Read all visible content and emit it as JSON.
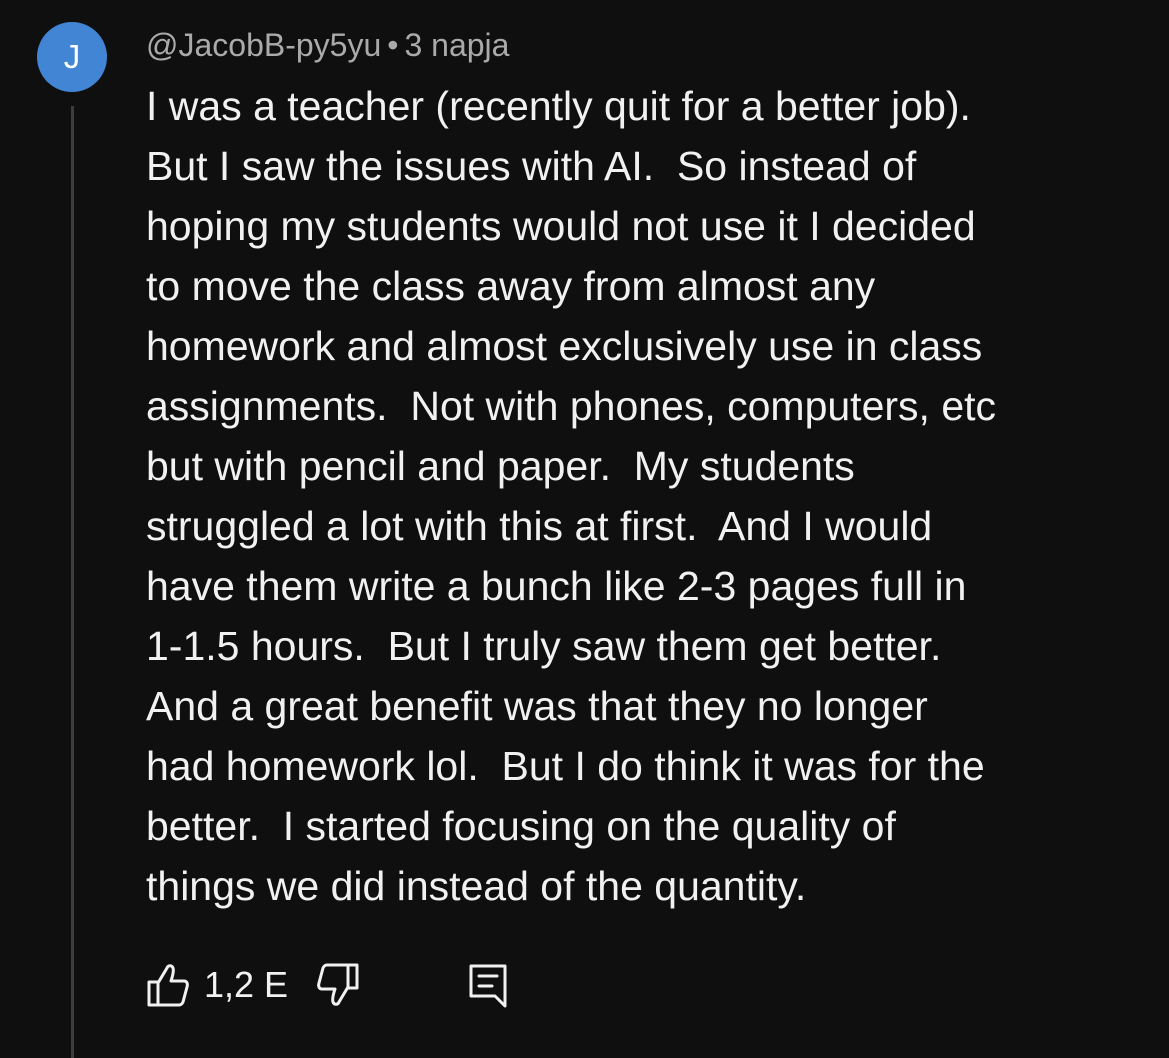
{
  "colors": {
    "avatar_bg": "#4285d4",
    "background": "#0f0f0f",
    "text_primary": "#f1f1f1",
    "text_secondary": "#aaaaaa"
  },
  "comment": {
    "avatar_letter": "J",
    "author": "@JacobB-py5yu",
    "separator": "•",
    "timestamp": "3 napja",
    "text_lines": [
      "I was a teacher (recently quit for a better job).",
      "But I saw the issues with AI.  So instead of",
      "hoping my students would not use it I decided",
      "to move the class away from almost any",
      "homework and almost exclusively use in class",
      "assignments.  Not with phones, computers, etc",
      "but with pencil and paper.  My students",
      "struggled a lot with this at first.  And I would",
      "have them write a bunch like 2-3 pages full in",
      "1-1.5 hours.  But I truly saw them get better.",
      "And a great benefit was that they no longer",
      "had homework lol.  But I do think it was for the",
      "better.  I started focusing on the quality of",
      "things we did instead of the quantity."
    ]
  },
  "actions": {
    "like_icon": "thumbs-up-icon",
    "like_count": "1,2 E",
    "dislike_icon": "thumbs-down-icon",
    "reply_icon": "comment-reply-icon"
  }
}
